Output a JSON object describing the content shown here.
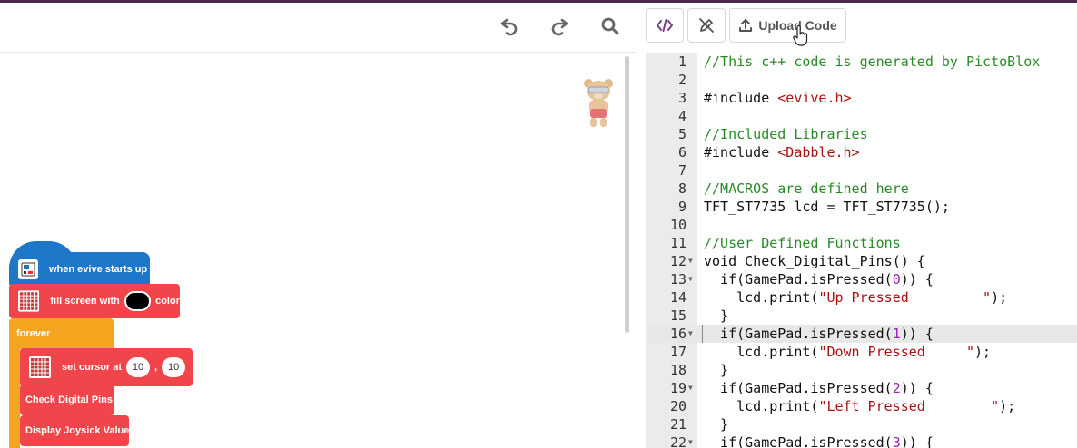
{
  "toolbar": {
    "upload_label": "Upload Code",
    "icons": [
      "undo-icon",
      "redo-icon",
      "search-icon",
      "code-view-icon",
      "no-pen-icon",
      "upload-icon"
    ]
  },
  "blocks": {
    "hat": "when evive starts up",
    "fill_prefix": "fill screen with",
    "fill_suffix": "color",
    "fill_color": "#000000",
    "forever": "forever",
    "setcursor_label": "set cursor at",
    "setcursor_x": "10",
    "setcursor_sep": ",",
    "setcursor_y": "10",
    "check_pins": "Check Digital Pins",
    "joystick": "Display Joysick Value"
  },
  "editor": {
    "active_line": 16,
    "lines": [
      {
        "n": "1",
        "text": "//This c++ code is generated by PictoBlox"
      },
      {
        "n": "2",
        "text": ""
      },
      {
        "n": "3",
        "text": "#include <evive.h>"
      },
      {
        "n": "4",
        "text": ""
      },
      {
        "n": "5",
        "text": "//Included Libraries"
      },
      {
        "n": "6",
        "text": "#include <Dabble.h>"
      },
      {
        "n": "7",
        "text": ""
      },
      {
        "n": "8",
        "text": "//MACROS are defined here"
      },
      {
        "n": "9",
        "text": "TFT_ST7735 lcd = TFT_ST7735();"
      },
      {
        "n": "10",
        "text": ""
      },
      {
        "n": "11",
        "text": "//User Defined Functions"
      },
      {
        "n": "12",
        "text": "void Check_Digital_Pins() {"
      },
      {
        "n": "13",
        "text": "  if(GamePad.isPressed(0)) {"
      },
      {
        "n": "14",
        "text": "    lcd.print(\"Up Pressed         \");"
      },
      {
        "n": "15",
        "text": "  }"
      },
      {
        "n": "16",
        "text": "  if(GamePad.isPressed(1)) {"
      },
      {
        "n": "17",
        "text": "    lcd.print(\"Down Pressed     \");"
      },
      {
        "n": "18",
        "text": "  }"
      },
      {
        "n": "19",
        "text": "  if(GamePad.isPressed(2)) {"
      },
      {
        "n": "20",
        "text": "    lcd.print(\"Left Pressed        \");"
      },
      {
        "n": "21",
        "text": "  }"
      },
      {
        "n": "22",
        "text": "  if(GamePad.isPressed(3)) {"
      }
    ],
    "fold_lines": [
      12,
      13,
      16,
      19,
      22
    ]
  },
  "colors": {
    "motion_blue": "#1f77c9",
    "display_red": "#f0454a",
    "control_orange": "#f5a51f",
    "comment_green": "#2a8a2a",
    "number_purple": "#9b1fb3"
  }
}
